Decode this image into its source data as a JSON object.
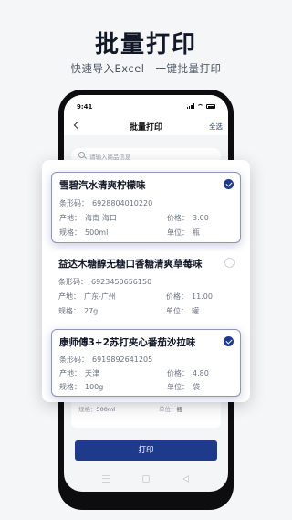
{
  "headline": "批量打印",
  "subline": "快速导入Excel　一键批量打印",
  "status": {
    "time": "9:41"
  },
  "nav": {
    "title": "批量打印",
    "select_all": "全选"
  },
  "search": {
    "placeholder": "请输入商品信息"
  },
  "products": [
    {
      "name": "雪碧汽水清爽柠檬味",
      "selected": true,
      "barcode_label": "条形码：",
      "barcode": "6928804010220",
      "origin_label": "产地：",
      "origin": "海南-海口",
      "price_label": "价格：",
      "price": "3.00",
      "spec_label": "规格：",
      "spec": "500ml",
      "unit_label": "单位：",
      "unit": "瓶"
    },
    {
      "name": "益达木糖醇无糖口香糖清爽草莓味",
      "selected": false,
      "barcode_label": "条形码：",
      "barcode": "6923450656150",
      "origin_label": "产地：",
      "origin": "广东-广州",
      "price_label": "价格：",
      "price": "11.00",
      "spec_label": "规格：",
      "spec": "27g",
      "unit_label": "单位：",
      "unit": "罐"
    },
    {
      "name": "康师傅3+2苏打夹心番茄沙拉味",
      "selected": true,
      "barcode_label": "条形码：",
      "barcode": "6919892641205",
      "origin_label": "产地：",
      "origin": "天津",
      "price_label": "价格：",
      "price": "4.80",
      "spec_label": "规格：",
      "spec": "100g",
      "unit_label": "单位：",
      "unit": "袋"
    }
  ],
  "background_row": {
    "spec_label": "规格：",
    "spec": "500ml",
    "unit_label": "单位：",
    "unit": "瓶"
  },
  "print_button": "打印",
  "colors": {
    "accent": "#1e3a8a",
    "background": "#f5f6f8"
  }
}
